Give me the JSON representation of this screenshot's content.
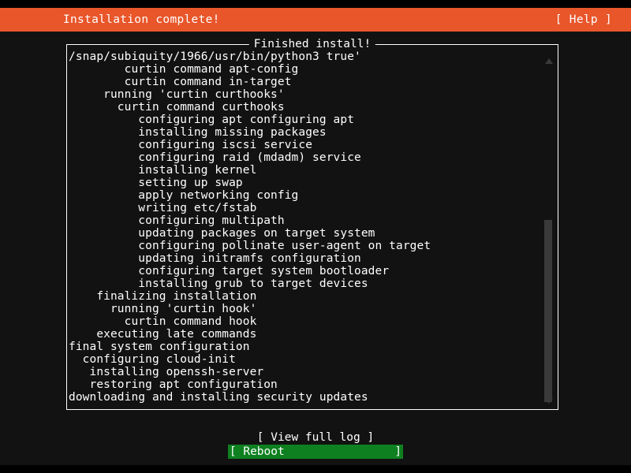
{
  "header": {
    "title": "Installation complete!",
    "help_label": "[ Help ]",
    "background_color": "#e8562a"
  },
  "log_panel": {
    "frame_title": "Finished install!",
    "lines": [
      "/snap/subiquity/1966/usr/bin/python3 true'",
      "        curtin command apt-config",
      "        curtin command in-target",
      "     running 'curtin curthooks'",
      "       curtin command curthooks",
      "          configuring apt configuring apt",
      "          installing missing packages",
      "          configuring iscsi service",
      "          configuring raid (mdadm) service",
      "          installing kernel",
      "          setting up swap",
      "          apply networking config",
      "          writing etc/fstab",
      "          configuring multipath",
      "          updating packages on target system",
      "          configuring pollinate user-agent on target",
      "          updating initramfs configuration",
      "          configuring target system bootloader",
      "          installing grub to target devices",
      "    finalizing installation",
      "      running 'curtin hook'",
      "        curtin command hook",
      "    executing late commands",
      "final system configuration",
      "  configuring cloud-init",
      "   installing openssh-server",
      "   restoring apt configuration",
      "downloading and installing security updates"
    ],
    "scrollbar": {
      "up_arrow": "scroll-up-arrow",
      "down_arrow": "scroll-down-arrow",
      "thumb_color": "#3a3a3a"
    }
  },
  "footer": {
    "view_log_label": "[ View full log ]",
    "reboot_label": "[ Reboot                ]",
    "reboot_highlight_color": "#0e8020"
  }
}
